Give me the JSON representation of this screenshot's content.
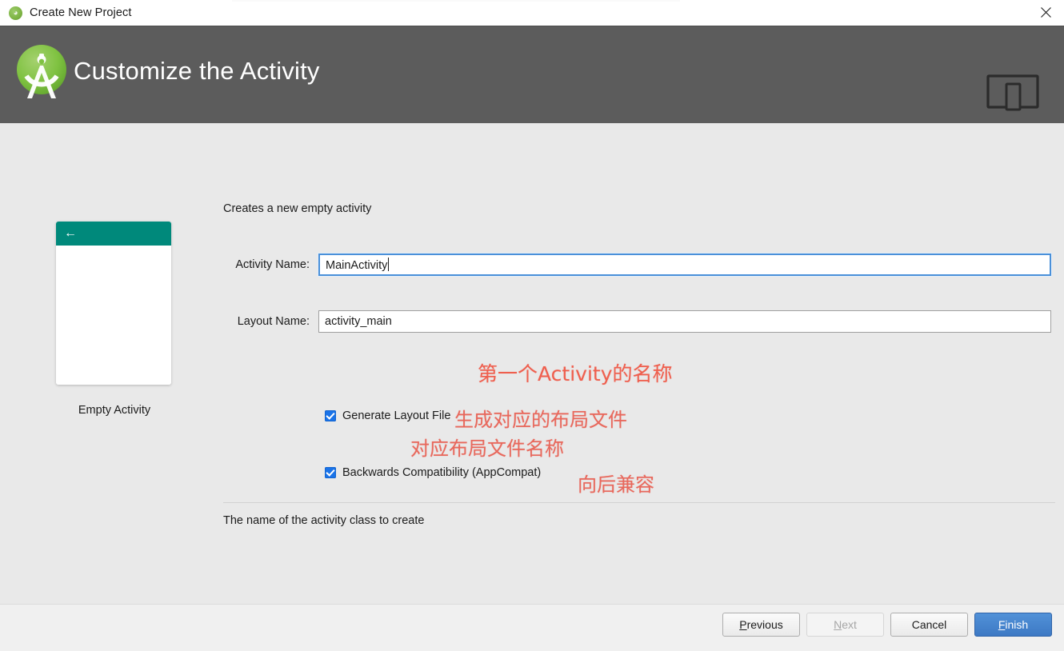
{
  "window": {
    "title": "Create New Project",
    "app_icon": "android-studio-icon",
    "close_icon": "close-icon"
  },
  "header": {
    "title": "Customize the Activity",
    "logo_icon": "android-studio-logo",
    "device_icon": "device-preview-icon",
    "background_color": "#5c5c5c"
  },
  "preview": {
    "back_icon": "back-arrow-icon",
    "appbar_color": "#00897b",
    "label": "Empty Activity"
  },
  "form": {
    "description": "Creates a new empty activity",
    "activity_name": {
      "label": "Activity Name:",
      "value": "MainActivity",
      "focused": true,
      "focus_color": "#4a90d9"
    },
    "generate_layout_file": {
      "label": "Generate Layout File",
      "checked": true
    },
    "layout_name": {
      "label": "Layout Name:",
      "value": "activity_main",
      "focused": false
    },
    "backwards_compatibility": {
      "label": "Backwards Compatibility (AppCompat)",
      "checked": true
    },
    "checkbox_color": "#1a73e8"
  },
  "annotations": {
    "color": "#e8685c",
    "activity_name_note": "第一个Activity的名称",
    "generate_layout_note": "生成对应的布局文件",
    "layout_name_note": "对应布局文件名称",
    "backwards_compat_note": "向后兼容"
  },
  "help": {
    "text": "The name of the activity class to create"
  },
  "footer": {
    "previous": {
      "prefix": "",
      "mnemonic": "P",
      "suffix": "revious",
      "disabled": false
    },
    "next": {
      "prefix": "",
      "mnemonic": "N",
      "suffix": "ext",
      "disabled": true
    },
    "cancel": {
      "prefix": "",
      "mnemonic": "",
      "suffix": "Cancel",
      "disabled": false
    },
    "finish": {
      "prefix": "",
      "mnemonic": "F",
      "suffix": "inish",
      "disabled": false,
      "primary_color": "#3d79c4"
    }
  }
}
